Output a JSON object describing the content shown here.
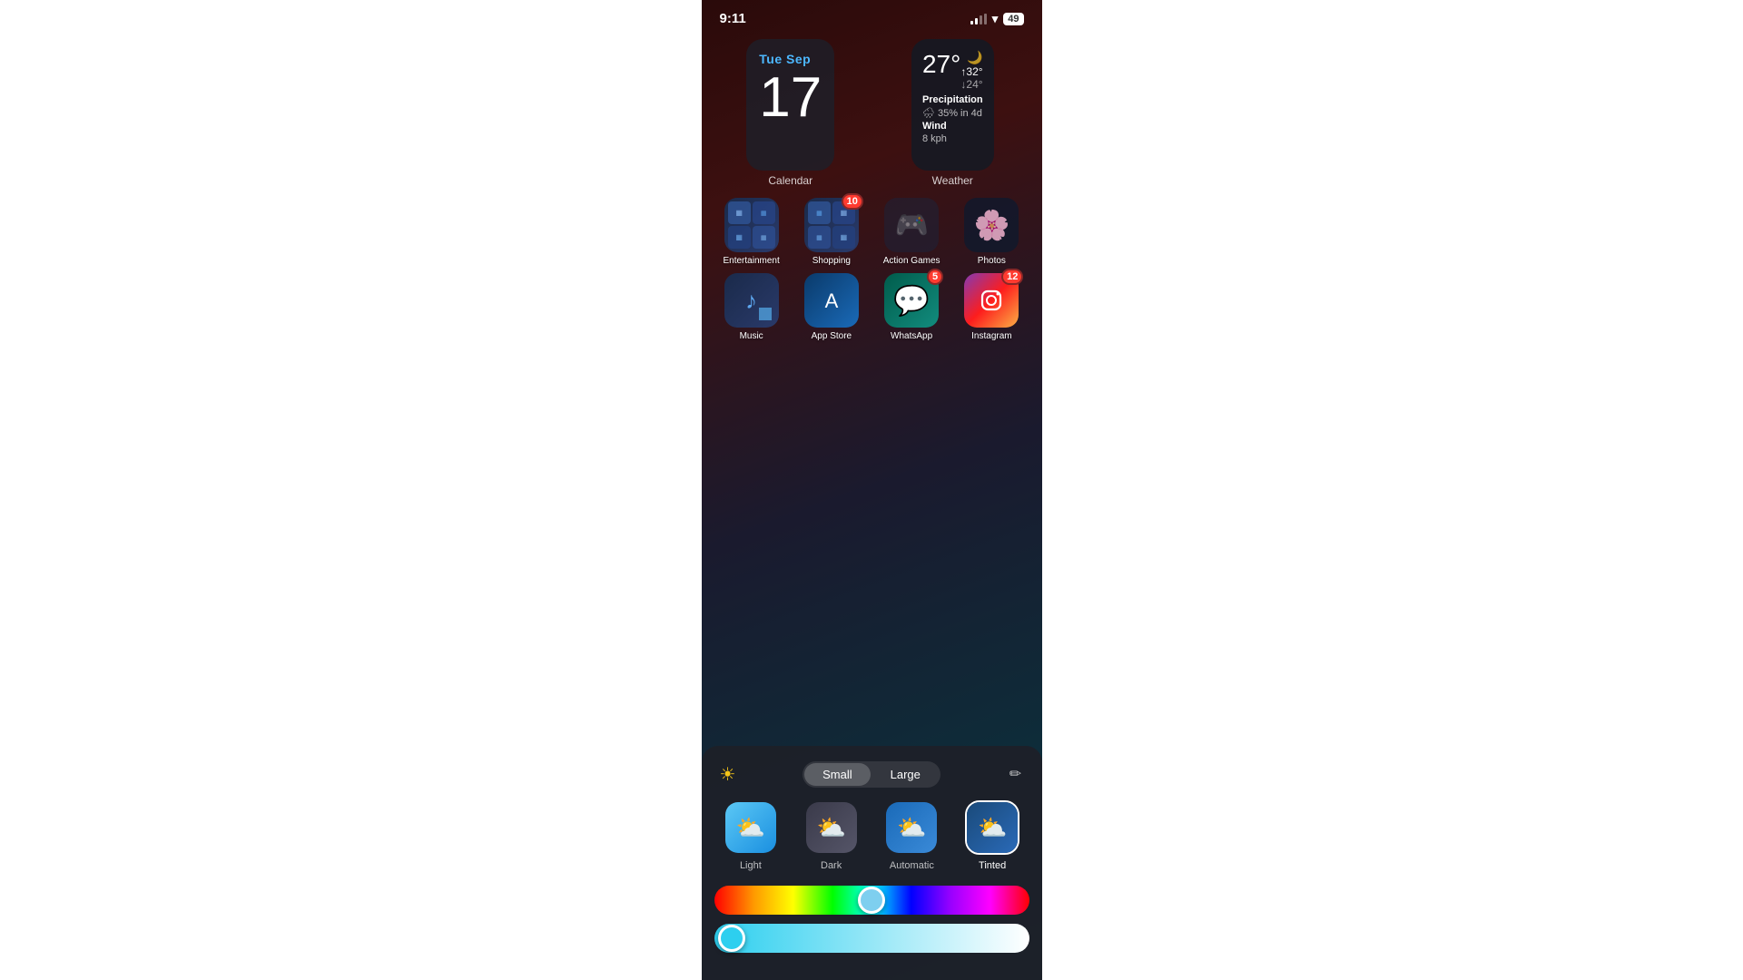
{
  "statusBar": {
    "time": "9:11",
    "battery": "49"
  },
  "widgets": {
    "calendar": {
      "dayLabel": "Tue Sep",
      "dateNumber": "17",
      "widgetLabel": "Calendar"
    },
    "weather": {
      "temp": "27°",
      "high": "↑32°",
      "low": "↓24°",
      "precipitation": "Precipitation",
      "precipValue": "35% in 4d",
      "wind": "Wind",
      "windValue": "8 kph",
      "widgetLabel": "Weather"
    }
  },
  "apps": {
    "row1": [
      {
        "label": "Entertainment",
        "type": "folder"
      },
      {
        "label": "Shopping",
        "type": "folder",
        "badge": "10"
      },
      {
        "label": "Action Games",
        "type": "folder"
      },
      {
        "label": "Photos",
        "type": "folder"
      }
    ],
    "row2": [
      {
        "label": "Music",
        "type": "music"
      },
      {
        "label": "App Store",
        "type": "appstore"
      },
      {
        "label": "WhatsApp",
        "type": "whatsapp",
        "badge": "5"
      },
      {
        "label": "Instagram",
        "type": "instagram",
        "badge": "12"
      }
    ]
  },
  "customizationPanel": {
    "sizeButtons": [
      {
        "label": "Small",
        "active": true
      },
      {
        "label": "Large",
        "active": false
      }
    ],
    "styleOptions": [
      {
        "label": "Light",
        "selected": false,
        "type": "light"
      },
      {
        "label": "Dark",
        "selected": false,
        "type": "dark"
      },
      {
        "label": "Automatic",
        "selected": false,
        "type": "automatic"
      },
      {
        "label": "Tinted",
        "selected": true,
        "type": "tinted"
      }
    ],
    "rainbowSliderThumbPosition": "50%",
    "saturationSliderThumbPosition": "2%"
  }
}
